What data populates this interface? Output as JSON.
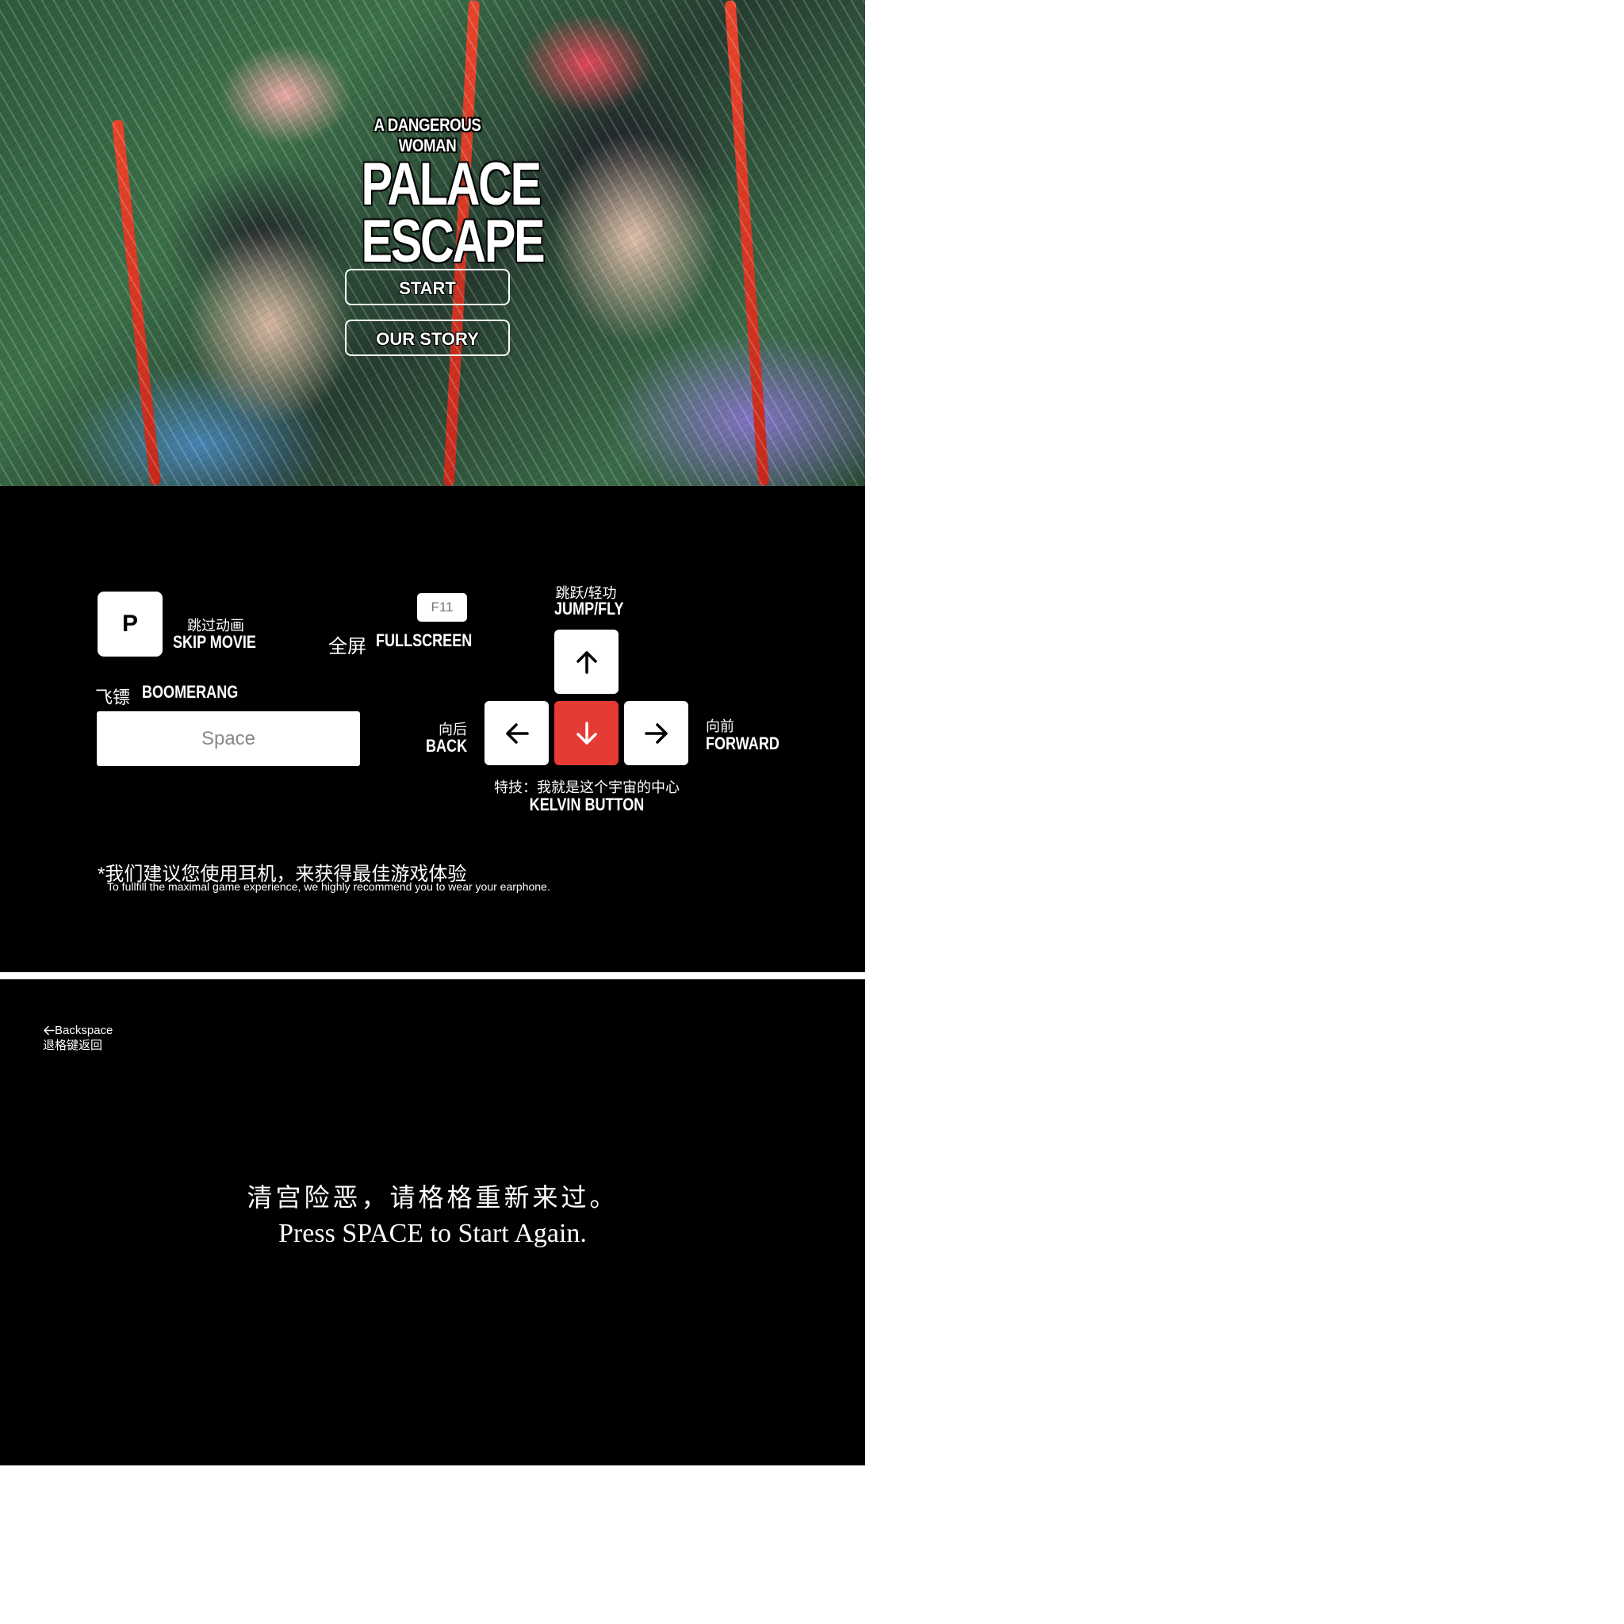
{
  "title_screen": {
    "subtitle": "A DANGEROUS WOMAN",
    "title_line1": "PALACE",
    "title_line2": "ESCAPE",
    "buttons": {
      "start": "START",
      "story": "OUR STORY"
    }
  },
  "controls": {
    "skip": {
      "key": "P",
      "cn": "跳过动画",
      "en": "SKIP MOVIE"
    },
    "fullscreen": {
      "key": "F11",
      "cn": "全屏",
      "en": "FULLSCREEN"
    },
    "boomerang": {
      "key": "Space",
      "cn": "飞镖",
      "en": "BOOMERANG"
    },
    "jump": {
      "cn": "跳跃/轻功",
      "en": "JUMP/FLY",
      "icon": "arrow-up-icon"
    },
    "back": {
      "cn": "向后",
      "en": "BACK",
      "icon": "arrow-left-icon"
    },
    "forward": {
      "cn": "向前",
      "en": "FORWARD",
      "icon": "arrow-right-icon"
    },
    "special": {
      "cn": "特技：我就是这个宇宙的中心",
      "en": "KELVIN BUTTON",
      "icon": "arrow-down-icon",
      "color": "#e63a35"
    },
    "note_cn": "*我们建议您使用耳机，来获得最佳游戏体验",
    "note_en": "To fullfill the maximal game experience, we highly recommend you to wear your earphone."
  },
  "gameover": {
    "back_hint_en": "Backspace",
    "back_hint_cn": "退格键返回",
    "message_cn": "清宫险恶，请格格重新来过。",
    "message_en": "Press SPACE to Start Again."
  }
}
